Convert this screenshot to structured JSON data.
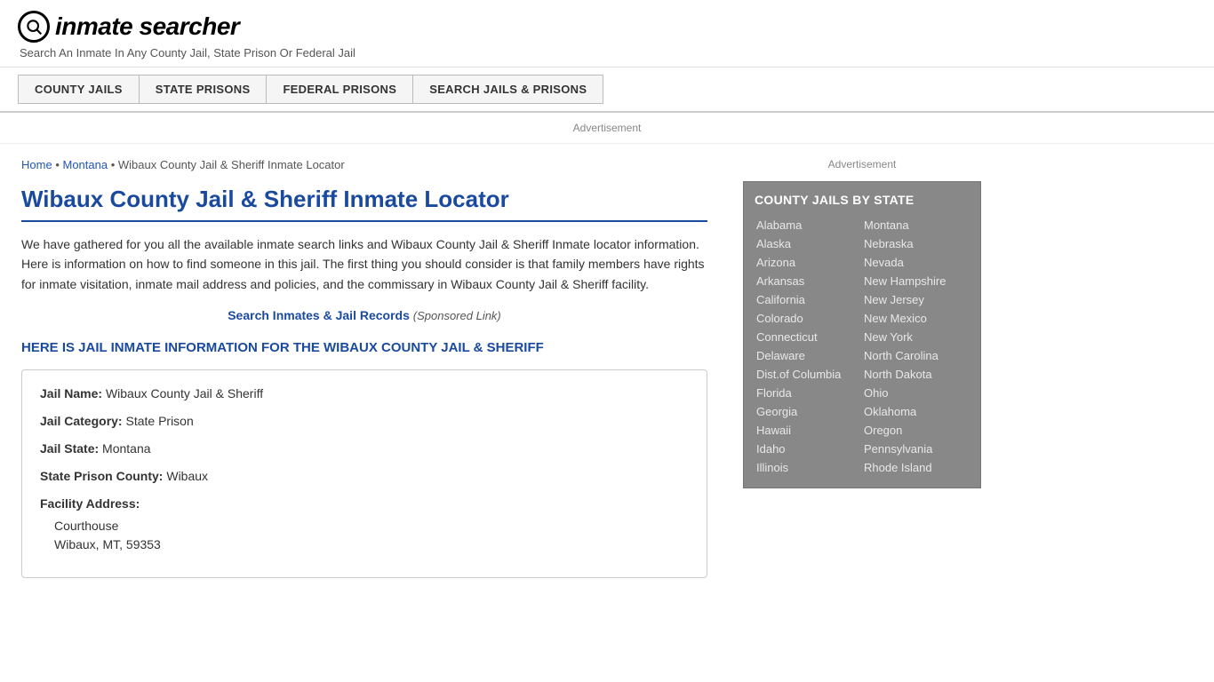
{
  "header": {
    "logo_icon": "🔍",
    "logo_text": "inmate searcher",
    "tagline": "Search An Inmate In Any County Jail, State Prison Or Federal Jail"
  },
  "nav": {
    "items": [
      {
        "label": "COUNTY JAILS",
        "id": "county-jails"
      },
      {
        "label": "STATE PRISONS",
        "id": "state-prisons"
      },
      {
        "label": "FEDERAL PRISONS",
        "id": "federal-prisons"
      },
      {
        "label": "SEARCH JAILS & PRISONS",
        "id": "search-jails"
      }
    ]
  },
  "ad": {
    "banner_text": "Advertisement",
    "sidebar_text": "Advertisement"
  },
  "breadcrumb": {
    "home": "Home",
    "state": "Montana",
    "page": "Wibaux County Jail & Sheriff Inmate Locator"
  },
  "page_title": "Wibaux County Jail & Sheriff Inmate Locator",
  "description": "We have gathered for you all the available inmate search links and Wibaux County Jail & Sheriff Inmate locator information. Here is information on how to find someone in this jail. The first thing you should consider is that family members have rights for inmate visitation, inmate mail address and policies, and the commissary in Wibaux County Jail & Sheriff facility.",
  "search_link": {
    "text": "Search Inmates & Jail Records",
    "sponsored": "(Sponsored Link)"
  },
  "jail_info_heading": "HERE IS JAIL INMATE INFORMATION FOR THE WIBAUX COUNTY JAIL & SHERIFF",
  "jail_details": {
    "name_label": "Jail Name:",
    "name_value": "Wibaux County Jail & Sheriff",
    "category_label": "Jail Category:",
    "category_value": "State Prison",
    "state_label": "Jail State:",
    "state_value": "Montana",
    "county_label": "State Prison County:",
    "county_value": "Wibaux",
    "address_label": "Facility Address:",
    "address_line1": "Courthouse",
    "address_line2": "Wibaux, MT, 59353"
  },
  "sidebar": {
    "title": "COUNTY JAILS BY STATE",
    "col1": [
      "Alabama",
      "Alaska",
      "Arizona",
      "Arkansas",
      "California",
      "Colorado",
      "Connecticut",
      "Delaware",
      "Dist.of Columbia",
      "Florida",
      "Georgia",
      "Hawaii",
      "Idaho",
      "Illinois"
    ],
    "col2": [
      "Montana",
      "Nebraska",
      "Nevada",
      "New Hampshire",
      "New Jersey",
      "New Mexico",
      "New York",
      "North Carolina",
      "North Dakota",
      "Ohio",
      "Oklahoma",
      "Oregon",
      "Pennsylvania",
      "Rhode Island"
    ]
  }
}
